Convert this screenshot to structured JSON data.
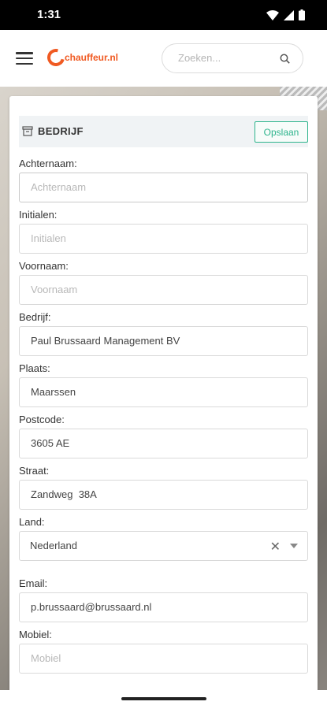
{
  "status": {
    "time": "1:31"
  },
  "header": {
    "logo_text": "chauffeur.nl",
    "search_placeholder": "Zoeken...",
    "brand_color": "#f05a22"
  },
  "card": {
    "title": "BEDRIJF",
    "save_label": "Opslaan",
    "accent_color": "#2db48c"
  },
  "fields": {
    "achternaam": {
      "label": "Achternaam:",
      "value": "",
      "placeholder": "Achternaam"
    },
    "initialen": {
      "label": "Initialen:",
      "value": "",
      "placeholder": "Initialen"
    },
    "voornaam": {
      "label": "Voornaam:",
      "value": "",
      "placeholder": "Voornaam"
    },
    "bedrijf": {
      "label": "Bedrijf:",
      "value": "Paul Brussaard Management BV",
      "placeholder": ""
    },
    "plaats": {
      "label": "Plaats:",
      "value": "Maarssen",
      "placeholder": ""
    },
    "postcode": {
      "label": "Postcode:",
      "value": "3605 AE",
      "placeholder": ""
    },
    "straat": {
      "label": "Straat:",
      "value": "Zandweg  38A",
      "placeholder": ""
    },
    "land": {
      "label": "Land:",
      "value": "Nederland"
    },
    "email": {
      "label": "Email:",
      "value": "p.brussaard@brussaard.nl",
      "placeholder": ""
    },
    "mobiel": {
      "label": "Mobiel:",
      "value": "",
      "placeholder": "Mobiel"
    }
  }
}
